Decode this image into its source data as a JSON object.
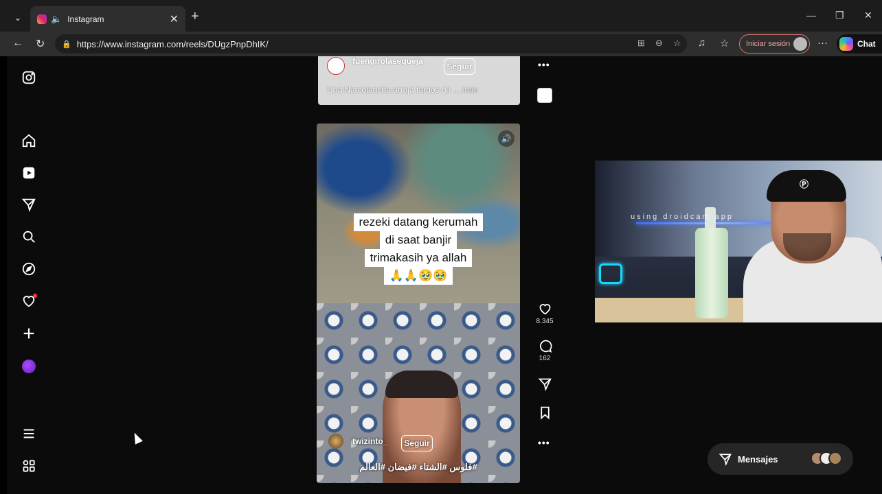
{
  "browser": {
    "tab_title": "Instagram",
    "url": "https://www.instagram.com/reels/DUgzPnpDhIK/",
    "signin_label": "Iniciar sesión",
    "copilot_label": "Chat"
  },
  "previous_reel": {
    "username": "fuengirolasequeja",
    "follow_label": "Seguir",
    "caption": "Una Narcolancha arroja fardos de",
    "more_label": "... más"
  },
  "reel": {
    "overlay_text": [
      "rezeki datang kerumah",
      "di saat banjir",
      "trimakasih ya allah",
      "🙏🙏🥹🥹"
    ],
    "username": "twizinto_",
    "follow_label": "Seguir",
    "caption": "#فلوس #الشتاء #فيضان #العالم",
    "likes": "8.345",
    "comments": "162"
  },
  "messages": {
    "label": "Mensajes"
  },
  "webcam": {
    "watermark": "using droidcam app"
  },
  "colors": {
    "page_bg": "#0b0b0b",
    "signin_border": "#e0786e",
    "notification": "#ff3040"
  }
}
